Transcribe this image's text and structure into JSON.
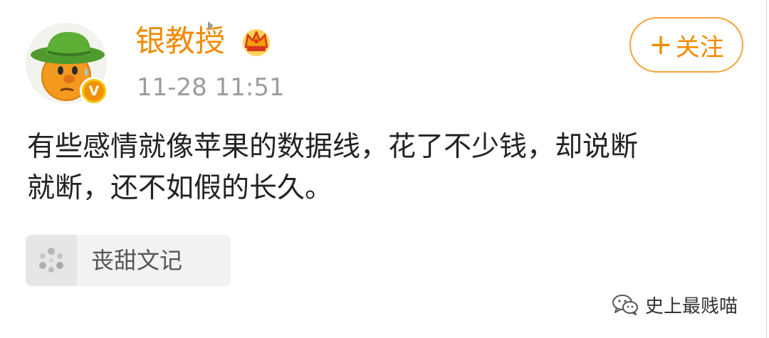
{
  "post": {
    "username": "银教授",
    "timestamp": "11-28 11:51",
    "follow_label": "关注",
    "text_lines": [
      "有些感情就像苹果的数据线，花了不少钱，却说断",
      "就断，还不如假的长久。"
    ],
    "verified_badge": "V",
    "topic": {
      "label": "丧甜文记"
    }
  },
  "watermark": {
    "label": "史上最贱喵"
  },
  "icons": {
    "crown": "crown-icon",
    "plus": "plus-icon",
    "topic": "topic-dots-icon",
    "arrow": "chevron-right-icon",
    "watermark": "wechat-icon"
  },
  "colors": {
    "accent": "#f18a00",
    "follow_border": "#f6a23a",
    "timestamp": "#9c9c9c",
    "text": "#222222",
    "topic_bg": "#f2f2f2",
    "badge": "#f6c400"
  }
}
